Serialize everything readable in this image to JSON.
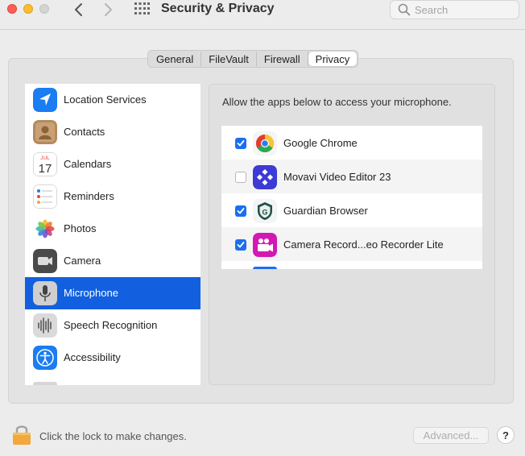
{
  "window": {
    "title": "Security & Privacy",
    "search_placeholder": "Search"
  },
  "tabs": [
    {
      "label": "General",
      "active": false
    },
    {
      "label": "FileVault",
      "active": false
    },
    {
      "label": "Firewall",
      "active": false
    },
    {
      "label": "Privacy",
      "active": true
    }
  ],
  "sidebar": {
    "selected": "Microphone",
    "items": [
      {
        "label": "Location Services",
        "icon": "location-arrow-icon"
      },
      {
        "label": "Contacts",
        "icon": "contacts-icon"
      },
      {
        "label": "Calendars",
        "icon": "calendar-icon",
        "icon_month": "JUL",
        "icon_day": "17"
      },
      {
        "label": "Reminders",
        "icon": "reminders-icon"
      },
      {
        "label": "Photos",
        "icon": "photos-icon"
      },
      {
        "label": "Camera",
        "icon": "camera-icon"
      },
      {
        "label": "Microphone",
        "icon": "microphone-icon"
      },
      {
        "label": "Speech Recognition",
        "icon": "speech-waveform-icon"
      },
      {
        "label": "Accessibility",
        "icon": "accessibility-icon"
      }
    ]
  },
  "content": {
    "description": "Allow the apps below to access your microphone.",
    "apps": [
      {
        "name": "Google Chrome",
        "checked": true,
        "icon": "chrome-icon"
      },
      {
        "name": "Movavi Video Editor 23",
        "checked": false,
        "icon": "movavi-icon"
      },
      {
        "name": "Guardian Browser",
        "checked": true,
        "icon": "guardian-shield-icon"
      },
      {
        "name": "Camera Record...eo Recorder Lite",
        "checked": true,
        "icon": "camera-recorder-icon"
      }
    ]
  },
  "footer": {
    "lock_text": "Click the lock to make changes.",
    "advanced_label": "Advanced...",
    "help_label": "?"
  },
  "colors": {
    "selection": "#1260e0",
    "checkbox": "#1a6ff0"
  }
}
